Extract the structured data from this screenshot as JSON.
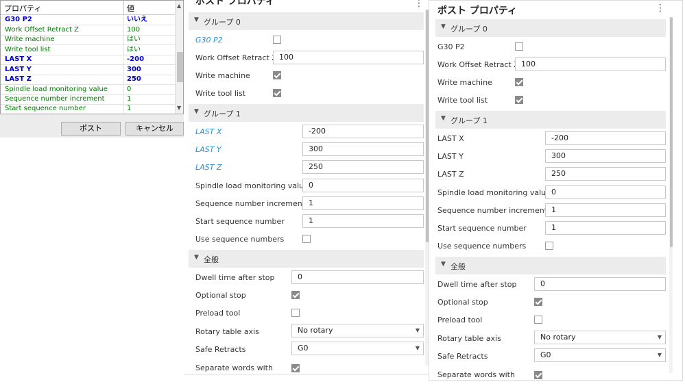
{
  "legacy": {
    "header": {
      "property": "プロパティ",
      "value": "値"
    },
    "rows": [
      {
        "key": "G30 P2",
        "value": "いいえ"
      },
      {
        "key": "Work Offset Retract Z",
        "value": "100"
      },
      {
        "key": "Write machine",
        "value": "はい"
      },
      {
        "key": "Write tool list",
        "value": "はい"
      },
      {
        "key": "LAST X",
        "value": "-200"
      },
      {
        "key": "LAST Y",
        "value": "300"
      },
      {
        "key": "LAST Z",
        "value": "250"
      },
      {
        "key": "Spindle load monitoring value",
        "value": "0"
      },
      {
        "key": "Sequence number increment",
        "value": "1"
      },
      {
        "key": "Start sequence number",
        "value": "1"
      }
    ],
    "post_button": "ポスト",
    "cancel_button": "キャンセル"
  },
  "panel_a": {
    "title": "ポスト プロパティ",
    "menu": "⋮",
    "groups": [
      "グループ 0",
      "グループ 1",
      "全般"
    ],
    "g30": "G30 P2",
    "work_offset_label": "Work Offset Retract Z",
    "work_offset_value": "100",
    "write_machine": "Write machine",
    "write_tool_list": "Write tool list",
    "last_x_label": "LAST X",
    "last_x_value": "-200",
    "last_y_label": "LAST Y",
    "last_y_value": "300",
    "last_z_label": "LAST Z",
    "last_z_value": "250",
    "spindle_label": "Spindle load monitoring value",
    "spindle_value": "0",
    "seq_inc_label": "Sequence number increment",
    "seq_inc_value": "1",
    "start_seq_label": "Start sequence number",
    "start_seq_value": "1",
    "use_seq": "Use sequence numbers",
    "dwell_label": "Dwell time after stop",
    "dwell_value": "0",
    "optional_stop": "Optional stop",
    "preload_tool": "Preload tool",
    "rotary_label": "Rotary table axis",
    "rotary_value": "No rotary",
    "safe_label": "Safe Retracts",
    "safe_value": "G0",
    "cutoff_label": "Separate words with"
  },
  "panel_b": {
    "title": "ポスト プロパティ",
    "menu": "⋮",
    "groups": [
      "グループ 0",
      "グループ 1",
      "全般"
    ],
    "g30": "G30 P2",
    "work_offset_label": "Work Offset Retract Z",
    "work_offset_value": "100",
    "write_machine": "Write machine",
    "write_tool_list": "Write tool list",
    "last_x_label": "LAST X",
    "last_x_value": "-200",
    "last_y_label": "LAST Y",
    "last_y_value": "300",
    "last_z_label": "LAST Z",
    "last_z_value": "250",
    "spindle_label": "Spindle load monitoring value",
    "spindle_value": "0",
    "seq_inc_label": "Sequence number increment",
    "seq_inc_value": "1",
    "start_seq_label": "Start sequence number",
    "start_seq_value": "1",
    "use_seq": "Use sequence numbers",
    "dwell_label": "Dwell time after stop",
    "dwell_value": "0",
    "optional_stop": "Optional stop",
    "preload_tool": "Preload tool",
    "rotary_label": "Rotary table axis",
    "rotary_value": "No rotary",
    "safe_label": "Safe Retracts",
    "safe_value": "G0",
    "cutoff_label": "Separate words with"
  },
  "colors": {
    "accent": "#2b8fd1",
    "legacy_blue": "#0000cc",
    "legacy_green": "#007a00"
  },
  "icons": {
    "expand": "triangle-down-icon",
    "menu": "vertical-ellipsis-icon",
    "dropdown": "caret-down-icon"
  }
}
